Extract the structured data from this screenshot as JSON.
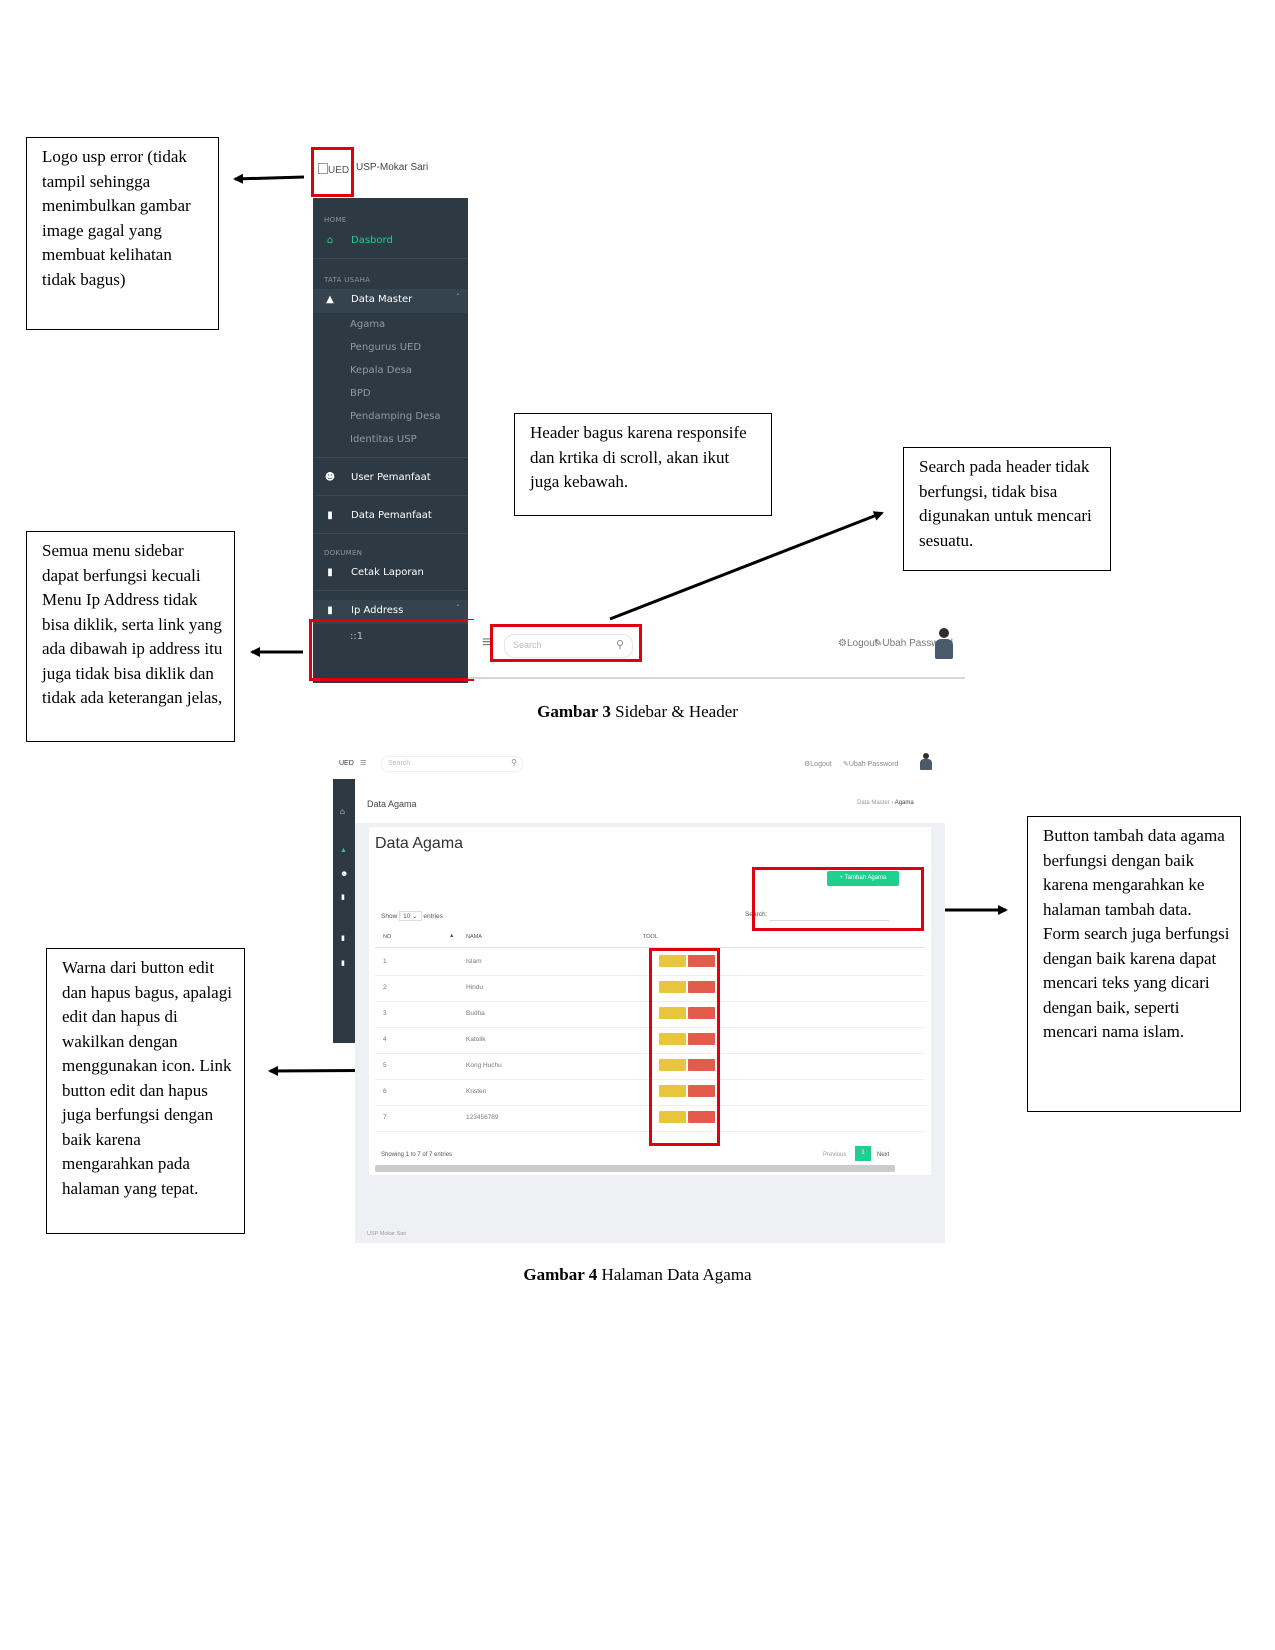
{
  "notes": {
    "logo": "Logo usp error (tidak tampil sehingga menimbulkan gambar image gagal yang membuat kelihatan tidak bagus)",
    "header": "Header bagus karena responsife dan krtika di scroll, akan ikut juga kebawah.",
    "search": "Search pada header tidak berfungsi, tidak bisa digunakan untuk mencari sesuatu.",
    "sidebar": "Semua menu sidebar dapat berfungsi kecuali Menu Ip Address tidak bisa diklik, serta link yang ada dibawah ip address itu juga tidak bisa diklik dan tidak ada keterangan jelas,",
    "tambah": "Button tambah data agama berfungsi dengan baik karena mengarahkan ke halaman tambah data. Form search juga berfungsi dengan baik karena dapat mencari teks yang dicari dengan baik, seperti mencari nama islam.",
    "warna": "Warna dari button edit dan hapus bagus, apalagi edit dan hapus di wakilkan dengan menggunakan icon. Link button edit dan hapus juga berfungsi dengan baik karena mengarahkan pada halaman yang tepat."
  },
  "captions": {
    "fig3_label": "Gambar 3",
    "fig3_text": " Sidebar & Header",
    "fig4_label": "Gambar 4",
    "fig4_text": " Halaman Data Agama"
  },
  "sidebar": {
    "logo_alt": "UED",
    "app_name": "USP-Mokar Sari",
    "sections": {
      "home": "HOME",
      "tata_usaha": "TATA USAHA",
      "dokumen": "DOKUMEN"
    },
    "dasbord": "Dasbord",
    "data_master": "Data Master",
    "submenu": [
      "Agama",
      "Pengurus UED",
      "Kepala Desa",
      "BPD",
      "Pendamping Desa",
      "Identitas USP"
    ],
    "user_pemanfaat": "User Pemanfaat",
    "data_pemanfaat": "Data Pemanfaat",
    "cetak_laporan": "Cetak Laporan",
    "ip_address": "Ip Address",
    "ip_value": "::1"
  },
  "header": {
    "search_placeholder": "Search",
    "logout": "Logout",
    "ubah_password": "Ubah Password"
  },
  "data_agama": {
    "brand": "UED",
    "search_placeholder": "Search",
    "logout": "Logout",
    "ubah_password": "Ubah Password",
    "page_heading": "Data Agama",
    "breadcrumb_parent": "Data Master",
    "breadcrumb_current": "Agama",
    "title": "Data Agama",
    "add_button": "+ Tambah Agama",
    "show": "Show",
    "show_value": "10",
    "entries": "entries",
    "search_label": "Search:",
    "columns": [
      "NO",
      "NAMA",
      "TOOL"
    ],
    "rows": [
      {
        "no": "1",
        "nama": "Islam"
      },
      {
        "no": "2",
        "nama": "Hindu"
      },
      {
        "no": "3",
        "nama": "Budha"
      },
      {
        "no": "4",
        "nama": "Katolik"
      },
      {
        "no": "5",
        "nama": "Kong Huchu"
      },
      {
        "no": "6",
        "nama": "Kristen"
      },
      {
        "no": "7",
        "nama": "123456789"
      }
    ],
    "info": "Showing 1 to 7 of 7 entries",
    "previous": "Previous",
    "page": "1",
    "next": "Next",
    "footer": "USP Mokar Sari"
  }
}
